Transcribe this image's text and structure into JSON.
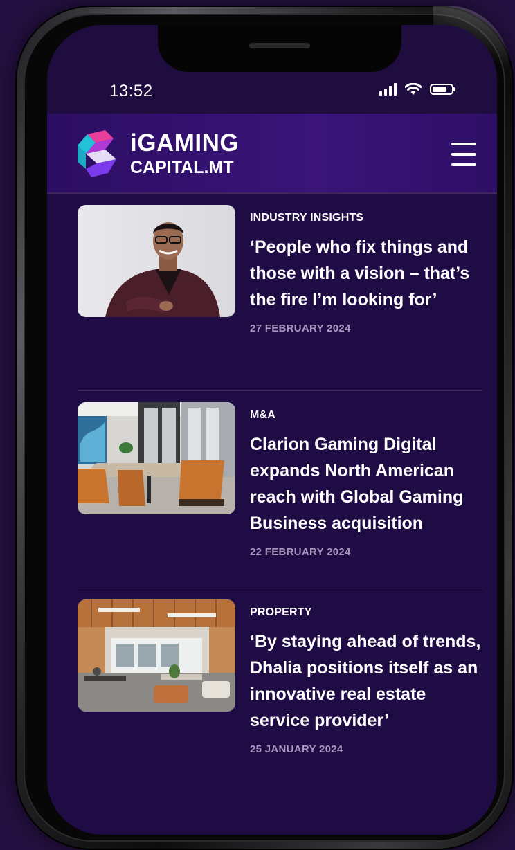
{
  "status_bar": {
    "time": "13:52"
  },
  "header": {
    "logo_line_1": "iGAMING",
    "logo_line_2": "CAPITAL.MT",
    "menu_icon": "hamburger-menu-icon"
  },
  "articles": [
    {
      "category": "INDUSTRY INSIGHTS",
      "title": "‘People who fix things and those with a vision – that’s the fire I’m looking for’",
      "date": "27 FEBRUARY 2024",
      "image": "portrait-man-glasses"
    },
    {
      "category": "M&A",
      "title": "Clarion Gaming Digital expands North American reach with Global Gaming Business acquisition",
      "date": "22 FEBRUARY 2024",
      "image": "meeting-room"
    },
    {
      "category": "PROPERTY",
      "title": "‘By staying ahead of trends, Dhalia positions itself as an innovative real estate service provider’",
      "date": "25 JANUARY 2024",
      "image": "open-office"
    }
  ],
  "colors": {
    "background": "#200c45",
    "header": "#3a1479",
    "text": "#ffffff",
    "date": "#a797bd",
    "logo_pink": "#e83e9c",
    "logo_cyan": "#22c3d8",
    "logo_purple": "#7c3aed"
  }
}
